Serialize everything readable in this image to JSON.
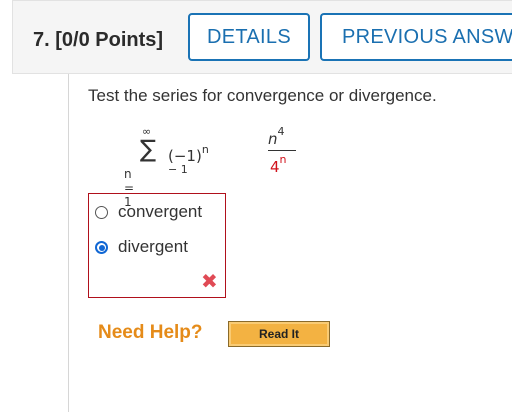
{
  "header": {
    "question_title": "7.  [0/0 Points]",
    "details_label": "DETAILS",
    "previous_label": "PREVIOUS ANSW"
  },
  "question": {
    "prompt": "Test the series for convergence or divergence.",
    "formula": {
      "upper_limit": "∞",
      "sigma": "∑",
      "lower_limit": "n = 1",
      "term_prefix": "(−1)",
      "term_exponent": "n − 1",
      "numerator_base": "n",
      "numerator_exp": "4",
      "denominator_base": "4",
      "denominator_exp": "n"
    }
  },
  "answers": {
    "options": [
      {
        "label": "convergent",
        "checked": false
      },
      {
        "label": "divergent",
        "checked": true
      }
    ],
    "result_icon": "incorrect-x-icon"
  },
  "help": {
    "need_help_label": "Need Help?",
    "read_it_label": "Read It"
  },
  "colors": {
    "accent_blue": "#1a6fb0",
    "error_red": "#b0101b",
    "help_orange": "#e58b19",
    "read_it_bg": "#f3b242"
  }
}
